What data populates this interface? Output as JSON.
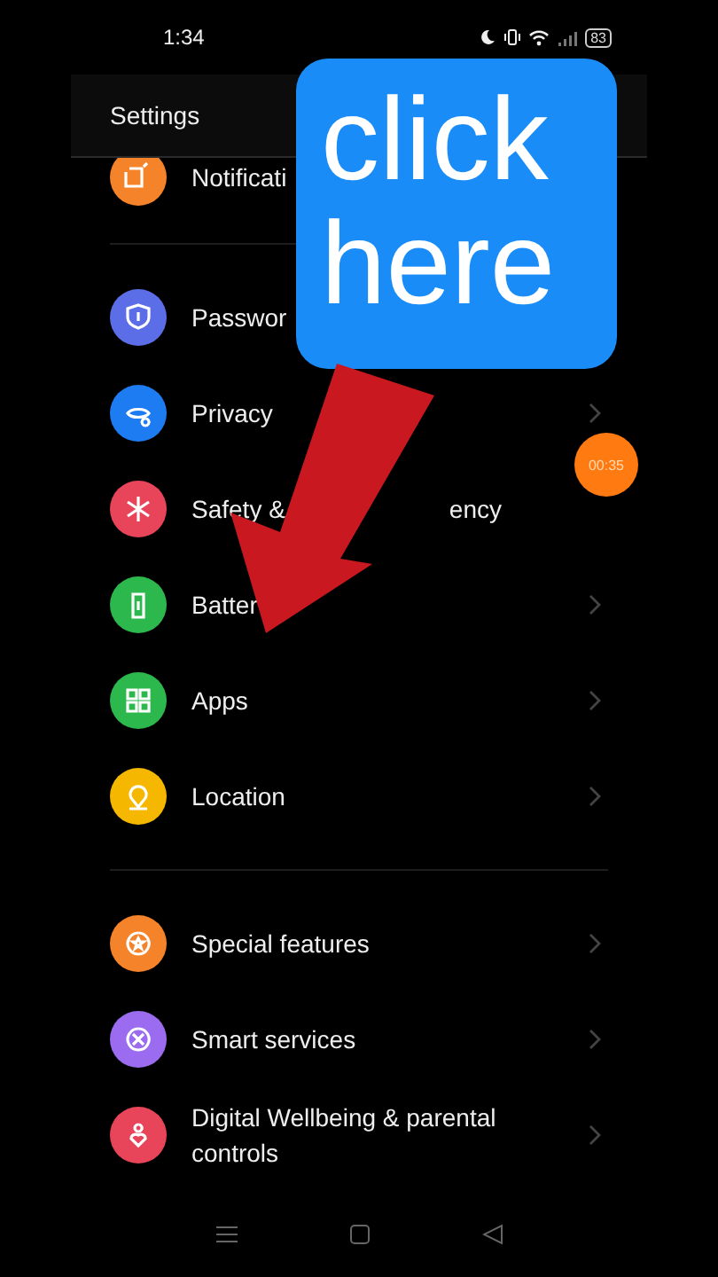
{
  "status_bar": {
    "time": "1:34",
    "battery": "83"
  },
  "header": {
    "title": "Settings"
  },
  "groups": [
    {
      "rows": [
        {
          "label": "Notificati",
          "color": "#f5832a",
          "chevron": false
        }
      ]
    },
    {
      "rows": [
        {
          "label": "Passwor",
          "color": "#5b6ee8",
          "chevron": false
        },
        {
          "label": "Privacy",
          "color": "#1e7cf2",
          "chevron": true
        },
        {
          "label": "Safety &",
          "label_end": "ency",
          "color": "#e8445a",
          "chevron": false
        },
        {
          "label": "Batter",
          "color": "#2db84d",
          "chevron": true
        },
        {
          "label": "Apps",
          "color": "#2db84d",
          "chevron": true
        },
        {
          "label": "Location",
          "color": "#f5b700",
          "chevron": true
        }
      ]
    },
    {
      "rows": [
        {
          "label": "Special features",
          "color": "#f5832a",
          "chevron": true
        },
        {
          "label": "Smart services",
          "color": "#9b6cf0",
          "chevron": true
        },
        {
          "label": "Digital Wellbeing & parental controls",
          "color": "#e8445a",
          "chevron": true
        }
      ]
    }
  ],
  "callout": {
    "text": "click here"
  },
  "timer": {
    "text": "00:35"
  }
}
